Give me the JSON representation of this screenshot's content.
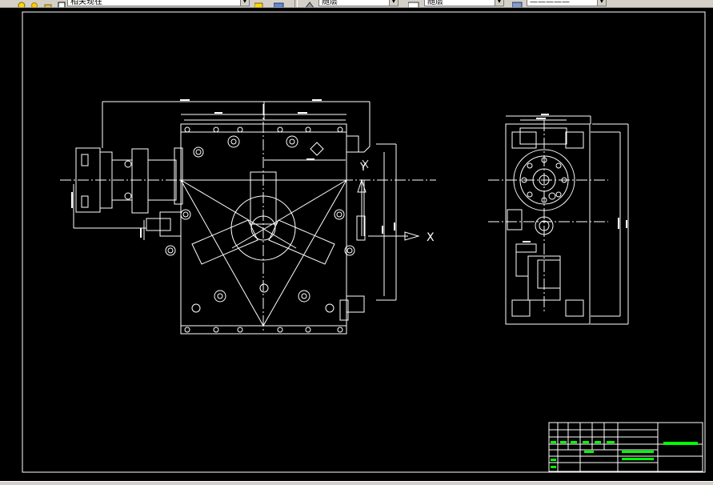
{
  "toolbar": {
    "layer_combo": {
      "value": "相关现在",
      "icon": "lightbulb-sun-lock-icons"
    },
    "color_combo": {
      "value": "随层"
    },
    "linetype_combo": {
      "value": "随层"
    },
    "lineweight_combo": {
      "value": "—————"
    }
  },
  "drawing": {
    "axis_x_label": "X",
    "axis_y_label": "Y"
  },
  "colors": {
    "background": "#000000",
    "lines": "#ffffff",
    "titleblock_green": "#00ff00"
  }
}
